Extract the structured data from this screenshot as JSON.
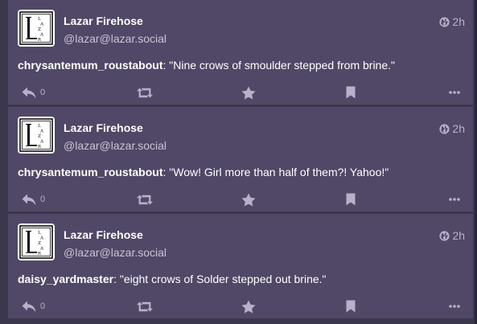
{
  "statuses": [
    {
      "display_name": "Lazar Firehose",
      "acct": "@lazar@lazar.social",
      "time": "2h",
      "author": "chrysantemum_roustabout",
      "text": ": \"Nine crows of smoulder stepped from brine.\"",
      "replies": "0"
    },
    {
      "display_name": "Lazar Firehose",
      "acct": "@lazar@lazar.social",
      "time": "2h",
      "author": "chrysantemum_roustabout",
      "text": ": \"Wow! Girl more than half of them?! Yahoo!\"",
      "replies": "0"
    },
    {
      "display_name": "Lazar Firehose",
      "acct": "@lazar@lazar.social",
      "time": "2h",
      "author": "daisy_yardmaster",
      "text": ": \"eight crows of Solder stepped out brine.\"",
      "replies": "0"
    }
  ],
  "icons": {
    "visibility": "globe-icon",
    "reply": "reply-icon",
    "boost": "boost-icon",
    "favourite": "star-icon",
    "bookmark": "bookmark-icon",
    "more": "more-icon"
  },
  "colors": {
    "background": "#3b374c",
    "card": "#504866",
    "text": "#ffffff",
    "muted": "#b7b1c9"
  }
}
